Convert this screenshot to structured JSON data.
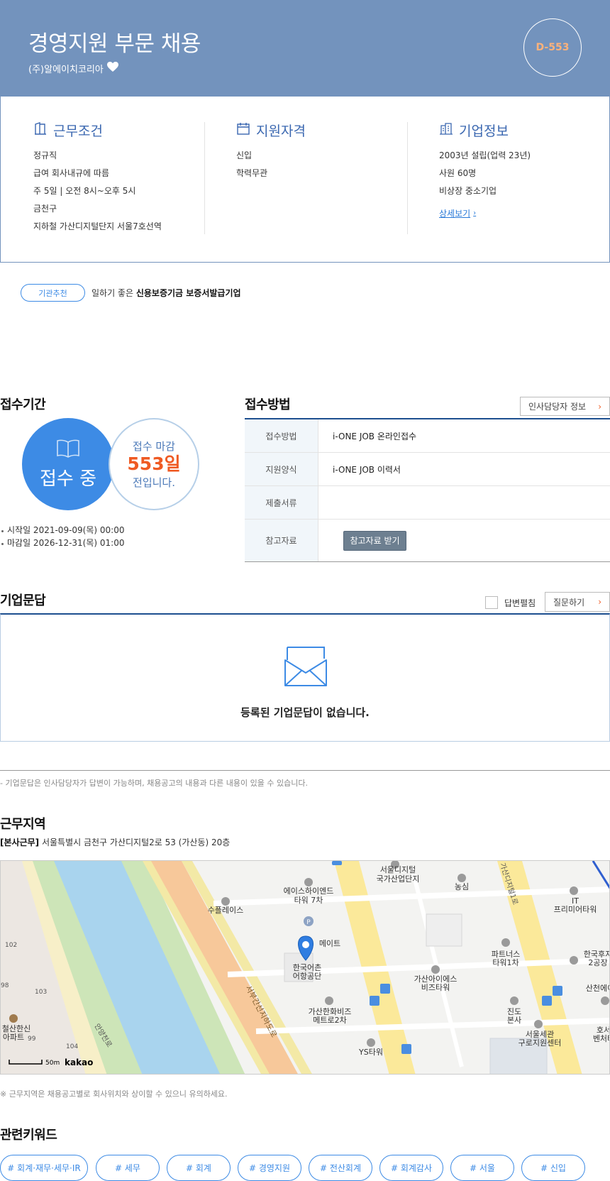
{
  "header": {
    "title": "경영지원 부문 채용",
    "company": "(주)알에이치코리아",
    "dday": "D-553"
  },
  "conditions": {
    "title": "근무조건",
    "items": [
      "정규직",
      "급여 회사내규에 따름",
      "주 5일 | 오전 8시~오후 5시",
      "금천구",
      "지하철 가산디지털단지 서울7호선역"
    ]
  },
  "qualification": {
    "title": "지원자격",
    "items": [
      "신입",
      "학력무관"
    ]
  },
  "company_info": {
    "title": "기업정보",
    "items": [
      "2003년 설립(업력 23년)",
      "사원 60명",
      "비상장 중소기업"
    ],
    "detail_link": "상세보기"
  },
  "recommend": {
    "badge": "기관추천",
    "text_prefix": "일하기 좋은 ",
    "text_bold": "신용보증기금 보증서발급기업"
  },
  "period": {
    "title": "접수기간",
    "status": "접수 중",
    "deadline_line1": "접수 마감",
    "deadline_days": "553일",
    "deadline_line3": "전입니다.",
    "start": "시작일 2021-09-09(목) 00:00",
    "end": "마감일 2026-12-31(목) 01:00"
  },
  "method": {
    "title": "접수방법",
    "hr_button": "인사담당자 정보",
    "rows": [
      {
        "label": "접수방법",
        "value": "i-ONE JOB 온라인접수"
      },
      {
        "label": "지원양식",
        "value": "i-ONE JOB 이력서"
      },
      {
        "label": "제출서류",
        "value": ""
      },
      {
        "label": "참고자료",
        "button": "참고자료 받기"
      }
    ]
  },
  "qa": {
    "title": "기업문답",
    "toggle_label": "답변펼침",
    "ask_button": "질문하기",
    "empty": "등록된 기업문답이 없습니다.",
    "note": "- 기업문답은 인사담당자가 답변이 가능하며, 채용공고의 내용과 다른 내용이 있을 수 있습니다."
  },
  "location": {
    "title": "근무지역",
    "tag": "[본사근무]",
    "address": " 서울특별시 금천구 가산디지털2로 53 (가산동) 20층",
    "note": "※ 근무지역은 채용공고별로 회사위치와 상이할 수 있으니 유의하세요.",
    "map": {
      "labels": [
        "서울디지털",
        "국가산업단지",
        "에이스하이엔드",
        "타워 7차",
        "농심",
        "IT",
        "프리미어타워",
        "수플레이스",
        "메이트",
        "한국어촌",
        "어항공단",
        "파트너스",
        "타워1차",
        "한국후지",
        "2공장",
        "가산아이에스",
        "비즈타워",
        "산천에이",
        "가산한화비즈",
        "메트로2차",
        "진도",
        "본사",
        "서울세관",
        "구로지원센터",
        "호서",
        "벤처타",
        "YS타워",
        "철산한신",
        "아파트",
        "서부간선지하도로",
        "안양천로",
        "가산디지털1로",
        "102",
        "103",
        "104",
        "99",
        "98"
      ],
      "scale": "50m",
      "brand": "kakao"
    }
  },
  "keywords": {
    "title": "관련키워드",
    "items": [
      "# 회계·재무·세무·IR",
      "# 세무",
      "# 회계",
      "# 경영지원",
      "# 전산회계",
      "# 회계감사",
      "# 서울",
      "# 신입"
    ]
  }
}
